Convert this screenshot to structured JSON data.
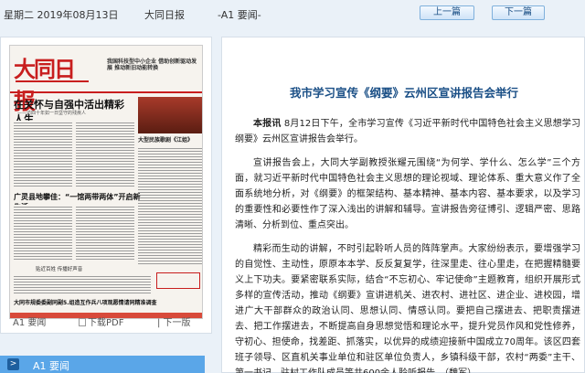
{
  "topbar": {
    "date": "星期二 2019年08月13日",
    "paper": "大同日报",
    "page": "-A1 要闻-",
    "prev_label": "上一篇",
    "next_label": "下一篇"
  },
  "thumbnail": {
    "masthead": "大同日报",
    "headline_right": "我国科技型中小企业 借助创新驱动发展 推动新旧动能转换",
    "headline_main": "在关怀与自强中活出精彩人生",
    "headline_main_sub": "——访四十年如一日坚守的残疾人",
    "photo_caption": "大型民族歌剧《江姐》",
    "headline_2": "广灵县地攀佳：“一馆两带两体”开启新生活",
    "headline_3": "贴近百姓 传播好声音",
    "headline_4": "大同市规委委副同副5.组造互作兵八项观愿情请同精准调查"
  },
  "left_footer": {
    "page_link": "A1 要闻",
    "pdf_link": "下载PDF",
    "next_page_link": "| 下一版"
  },
  "page_tab": {
    "arrow": ">",
    "label": "A1 要闻"
  },
  "article": {
    "title": "我市学习宣传《纲要》云州区宣讲报告会举行",
    "lead_label": "本报讯",
    "para1_rest": " 8月12日下午，全市学习宣传《习近平新时代中国特色社会主义思想学习纲要》云州区宣讲报告会举行。",
    "para2": "宣讲报告会上，大同大学副教授张耀元围绕“为何学、学什么、怎么学”三个方面，就习近平新时代中国特色社会主义思想的理论视域、理论体系、重大意义作了全面系统地分析，对《纲要》的框架结构、基本精神、基本内容、基本要求，以及学习的重要性和必要性作了深入浅出的讲解和辅导。宣讲报告旁征博引、逻辑严密、思路清晰、分析到位、重点突出。",
    "para3": "精彩而生动的讲解，不时引起聆听人员的阵阵掌声。大家纷纷表示，要增强学习的自觉性、主动性，原原本本学、反反复复学，往深里走、往心里走，在把握精髓要义上下功夫。要紧密联系实际，结合“不忘初心、牢记使命”主题教育，组织开展形式多样的宣传活动，推动《纲要》宣讲进机关、进农村、进社区、进企业、进校园，增进广大干部群众的政治认同、思想认同、情感认同。要把自己摆进去、把职责摆进去、把工作摆进去，不断提高自身思想觉悟和理论水平，提升党员作风和党性修养，守初心、担使命，找差距、抓落实，以优异的成绩迎接新中国成立70周年。该区四套班子领导、区直机关事业单位和驻区单位负责人，乡镇科级干部，农村“两委”主干、第一书记、驻村工作队成员等共600余人聆听报告。（魏军）"
  }
}
